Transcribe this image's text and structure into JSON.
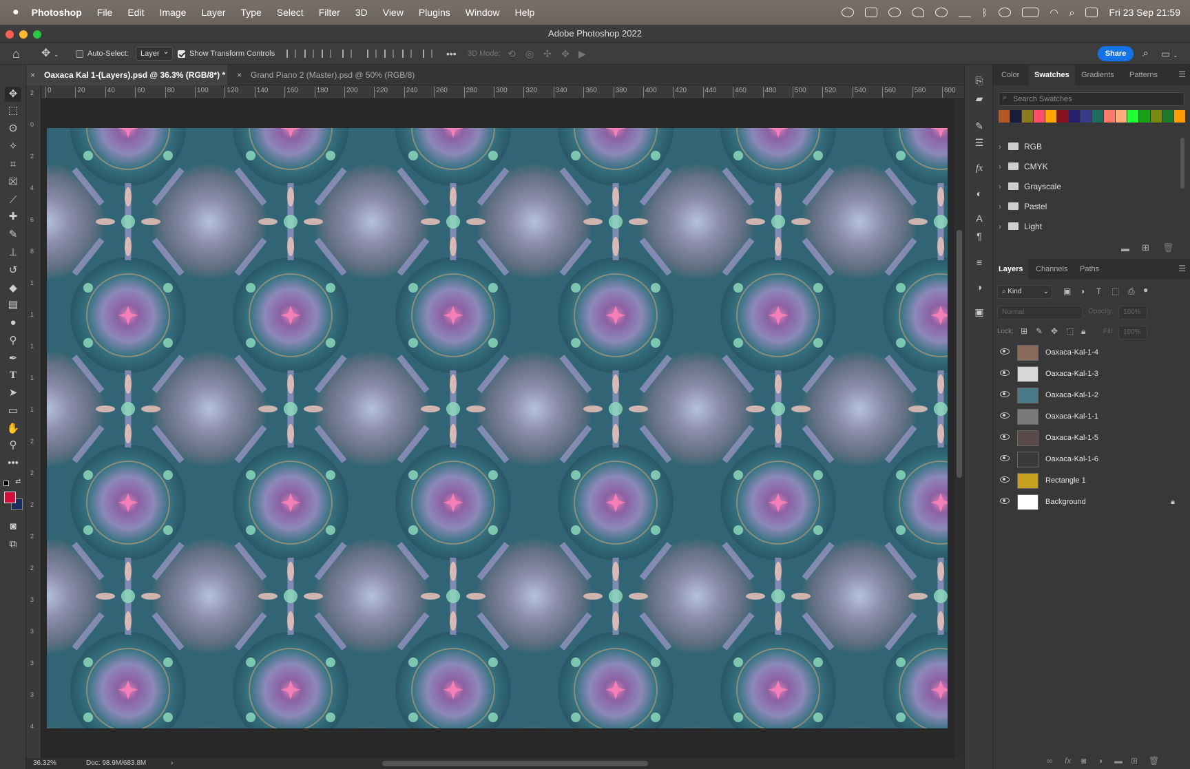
{
  "menubar": {
    "app_name": "Photoshop",
    "items": [
      "File",
      "Edit",
      "Image",
      "Layer",
      "Type",
      "Select",
      "Filter",
      "3D",
      "View",
      "Plugins",
      "Window",
      "Help"
    ],
    "datetime": "Fri 23 Sep  21:59"
  },
  "window": {
    "title": "Adobe Photoshop 2022"
  },
  "options": {
    "auto_select_label": "Auto-Select:",
    "auto_select_value": "Layer",
    "show_transform_label": "Show Transform Controls",
    "mode_3d": "3D Mode:",
    "share_label": "Share"
  },
  "tabs": [
    {
      "label": "Oaxaca Kal 1-(Layers).psd @ 36.3% (RGB/8*) *"
    },
    {
      "label": "Grand Piano 2 (Master).psd @ 50% (RGB/8)"
    }
  ],
  "ruler_h": [
    "0",
    "20",
    "40",
    "60",
    "80",
    "100",
    "120",
    "140",
    "160",
    "180",
    "200",
    "220",
    "240",
    "260",
    "280",
    "300",
    "320",
    "340",
    "360",
    "380",
    "400",
    "420",
    "440",
    "460",
    "480",
    "500",
    "520",
    "540",
    "560",
    "580",
    "600"
  ],
  "ruler_v": [
    "2",
    "0",
    "2",
    "4",
    "6",
    "8",
    "1",
    "1",
    "1",
    "1",
    "1",
    "2",
    "2",
    "2",
    "2",
    "2",
    "3",
    "3",
    "3",
    "3",
    "4"
  ],
  "status": {
    "zoom": "36.32%",
    "doc": "Doc: 98.9M/683.8M"
  },
  "colors": {
    "foreground": "#d0103a",
    "background": "#1b2d5c",
    "accent": "#1473e6"
  },
  "swatches_panel": {
    "tabs": [
      "Color",
      "Swatches",
      "Gradients",
      "Patterns"
    ],
    "active_tab": "Swatches",
    "search_placeholder": "Search Swatches",
    "swatch_colors": [
      "#b05a2a",
      "#1a1a3a",
      "#8a7a20",
      "#ff4d6a",
      "#ffa400",
      "#8a0f1f",
      "#2a1f6a",
      "#3a3a8a",
      "#1f6a5a",
      "#ff7a6a",
      "#ffb07a",
      "#20ff30",
      "#18a018",
      "#7a8a10",
      "#1f7a2a",
      "#ff9a00"
    ],
    "groups": [
      "RGB",
      "CMYK",
      "Grayscale",
      "Pastel",
      "Light"
    ]
  },
  "layers_panel": {
    "tabs": [
      "Layers",
      "Channels",
      "Paths"
    ],
    "active_tab": "Layers",
    "kind_label": "Kind",
    "blend_mode": "Normal",
    "opacity_label": "Opacity:",
    "opacity_value": "100%",
    "lock_label": "Lock:",
    "fill_label": "Fill:",
    "fill_value": "100%",
    "layers": [
      {
        "name": "Oaxaca-Kal-1-4",
        "thumb": "#8a6a5a"
      },
      {
        "name": "Oaxaca-Kal-1-3",
        "thumb": "#d8d8d8"
      },
      {
        "name": "Oaxaca-Kal-1-2",
        "thumb": "#4a7a8a"
      },
      {
        "name": "Oaxaca-Kal-1-1",
        "thumb": "#7a7a7a"
      },
      {
        "name": "Oaxaca-Kal-1-5",
        "thumb": "#5a4a4a"
      },
      {
        "name": "Oaxaca-Kal-1-6",
        "thumb": "#3a3a3a"
      },
      {
        "name": "Rectangle 1",
        "thumb": "#c8a020"
      },
      {
        "name": "Background",
        "thumb": "#ffffff",
        "locked": true
      }
    ]
  }
}
